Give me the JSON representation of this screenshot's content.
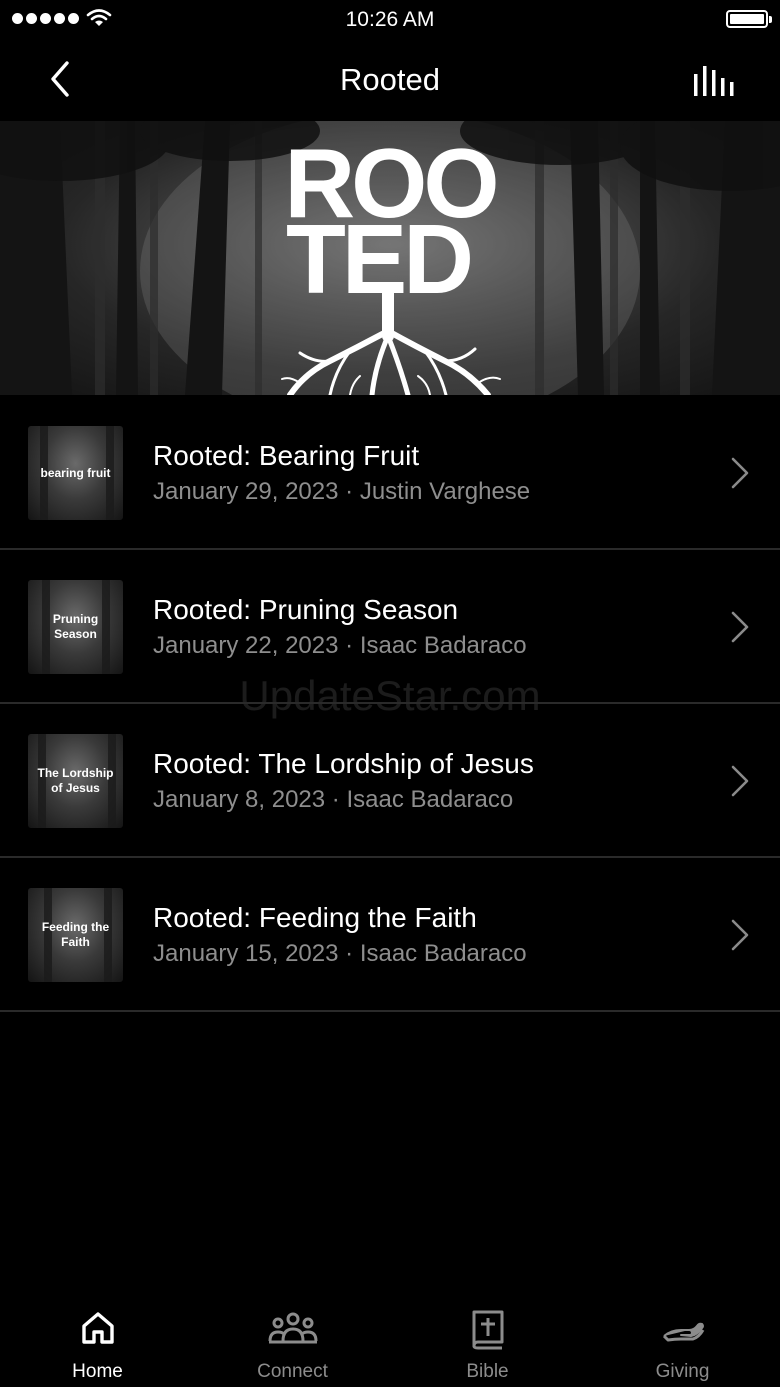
{
  "status_bar": {
    "time": "10:26 AM"
  },
  "nav": {
    "title": "Rooted"
  },
  "hero": {
    "line1": "ROO",
    "line2": "TED"
  },
  "sermons": [
    {
      "thumb_text": "bearing fruit",
      "title": "Rooted: Bearing Fruit",
      "date": "January 29, 2023",
      "separator": " · ",
      "speaker": "Justin Varghese"
    },
    {
      "thumb_text": "Pruning Season",
      "title": "Rooted: Pruning Season",
      "date": "January 22, 2023",
      "separator": " · ",
      "speaker": "Isaac Badaraco"
    },
    {
      "thumb_text": "The Lordship of Jesus",
      "title": "Rooted: The Lordship of Jesus",
      "date": "January 8, 2023",
      "separator": " · ",
      "speaker": "Isaac Badaraco"
    },
    {
      "thumb_text": "Feeding the Faith",
      "title": "Rooted: Feeding the Faith",
      "date": "January 15, 2023",
      "separator": " · ",
      "speaker": "Isaac Badaraco"
    }
  ],
  "watermark": "UpdateStar.com",
  "tabs": [
    {
      "label": "Home",
      "icon": "home-icon",
      "active": true
    },
    {
      "label": "Connect",
      "icon": "people-icon",
      "active": false
    },
    {
      "label": "Bible",
      "icon": "bible-icon",
      "active": false
    },
    {
      "label": "Giving",
      "icon": "giving-hand-icon",
      "active": false
    }
  ],
  "colors": {
    "background": "#000000",
    "text": "#ffffff",
    "secondary_text": "#8e8e8e",
    "divider": "#2a2a2a",
    "inactive_tab": "#8c8c8c"
  }
}
